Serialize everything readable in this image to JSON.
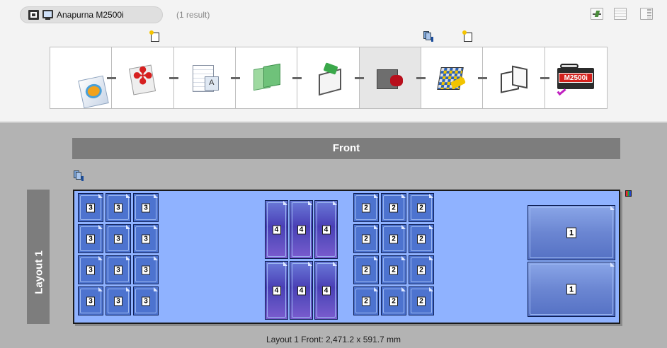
{
  "header": {
    "device_name": "Anapurna M2500i",
    "result_count": "(1 result)"
  },
  "workflow": {
    "steps": [
      {
        "name": "artwork-import-icon",
        "selected": false
      },
      {
        "name": "pdf-conversion-icon",
        "selected": false
      },
      {
        "name": "preflight-check-icon",
        "selected": false
      },
      {
        "name": "color-management-icon",
        "selected": false
      },
      {
        "name": "imposition-icon",
        "selected": false
      },
      {
        "name": "cutting-icon",
        "selected": true
      },
      {
        "name": "nesting-layout-icon",
        "selected": false
      },
      {
        "name": "output-packaging-icon",
        "selected": false
      },
      {
        "name": "printer-output-icon",
        "selected": false
      }
    ],
    "printer_label": "M2500i"
  },
  "layout": {
    "side_label": "Front",
    "tab_label": "Layout 1",
    "footer": "Layout 1 Front: 2,471.2 x 591.7 mm",
    "tile_numbers": {
      "left_group": "3",
      "tall_group": "4",
      "right_group": "2",
      "large_group": "1"
    }
  }
}
